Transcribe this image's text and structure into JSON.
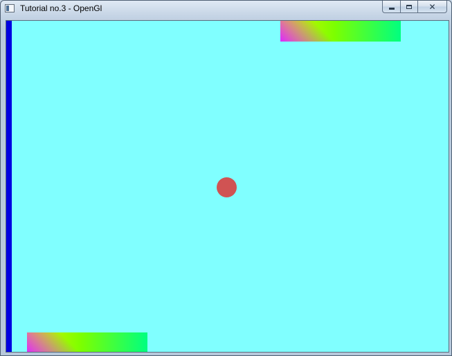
{
  "window": {
    "title": "Tutorial no.3 - OpenGl",
    "icon": "application-icon",
    "controls": {
      "minimize_icon": "minimize-icon",
      "maximize_icon": "maximize-icon",
      "close_icon": "close-icon",
      "close_glyph": "✕"
    }
  },
  "scene": {
    "background_color": "#80ffff",
    "wall_color": "#0000e0",
    "ball_color": "#d05353",
    "paddle_colors": [
      "#e7f000",
      "#7cff00",
      "#00ff80",
      "#dc28ff"
    ]
  }
}
